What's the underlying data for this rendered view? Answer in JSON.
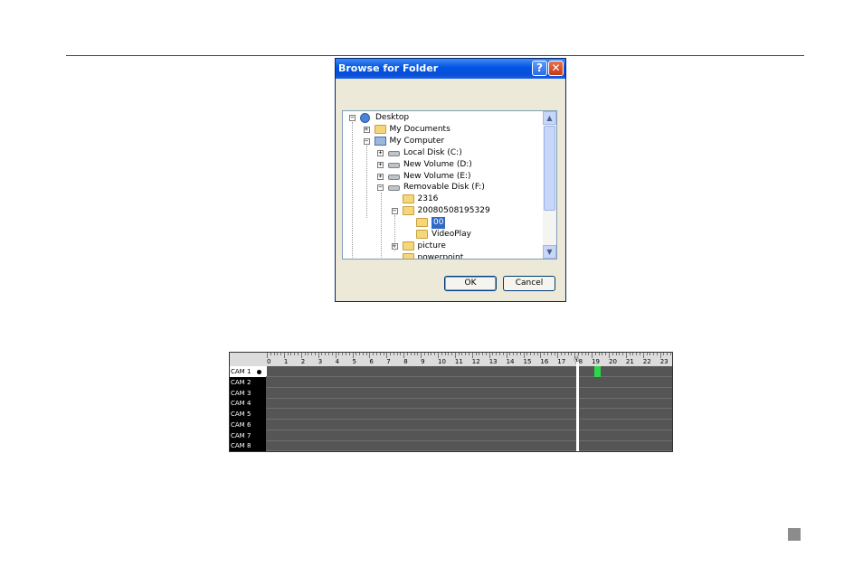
{
  "dialog": {
    "title": "Browse for Folder",
    "help_glyph": "?",
    "close_glyph": "✕",
    "tree": [
      {
        "label": "Desktop",
        "icon": "desktop-icon",
        "expander": "−",
        "level": 0
      },
      {
        "label": "My Documents",
        "icon": "folder-icon",
        "expander": "+",
        "level": 1
      },
      {
        "label": "My Computer",
        "icon": "computer-icon",
        "expander": "−",
        "level": 1
      },
      {
        "label": "Local Disk (C:)",
        "icon": "drive-icon",
        "expander": "+",
        "level": 2
      },
      {
        "label": "New Volume (D:)",
        "icon": "drive-icon",
        "expander": "+",
        "level": 2
      },
      {
        "label": "New Volume (E:)",
        "icon": "drive-icon",
        "expander": "+",
        "level": 2
      },
      {
        "label": "Removable Disk (F:)",
        "icon": "drive-icon",
        "expander": "−",
        "level": 2
      },
      {
        "label": "2316",
        "icon": "folder-icon",
        "expander": "",
        "level": 3
      },
      {
        "label": "20080508195329",
        "icon": "folder-icon",
        "expander": "−",
        "level": 3
      },
      {
        "label": "00",
        "icon": "open-folder-icon",
        "expander": "",
        "level": 4,
        "selected": true
      },
      {
        "label": "VideoPlay",
        "icon": "folder-icon",
        "expander": "",
        "level": 4
      },
      {
        "label": "picture",
        "icon": "folder-icon",
        "expander": "+",
        "level": 3
      },
      {
        "label": "powerpoint",
        "icon": "folder-icon",
        "expander": "",
        "level": 3
      }
    ],
    "ok_label": "OK",
    "cancel_label": "Cancel"
  },
  "timeline": {
    "hours": [
      "0",
      "1",
      "2",
      "3",
      "4",
      "5",
      "6",
      "7",
      "8",
      "9",
      "10",
      "11",
      "12",
      "13",
      "14",
      "15",
      "16",
      "17",
      "18",
      "19",
      "20",
      "21",
      "22",
      "23"
    ],
    "cameras": [
      "CAM 1",
      "CAM 2",
      "CAM 3",
      "CAM 4",
      "CAM 5",
      "CAM 6",
      "CAM 7",
      "CAM 8"
    ],
    "selected_camera": "CAM 1",
    "cursor_hour": 18.1,
    "recording": {
      "camera": "CAM 1",
      "start_hour": 19.0,
      "end_hour": 19.35,
      "color": "#2bd84a"
    },
    "colors": {
      "track": "#555555",
      "label_bg": "#000000",
      "ruler_bg": "#dcdcdc"
    }
  }
}
